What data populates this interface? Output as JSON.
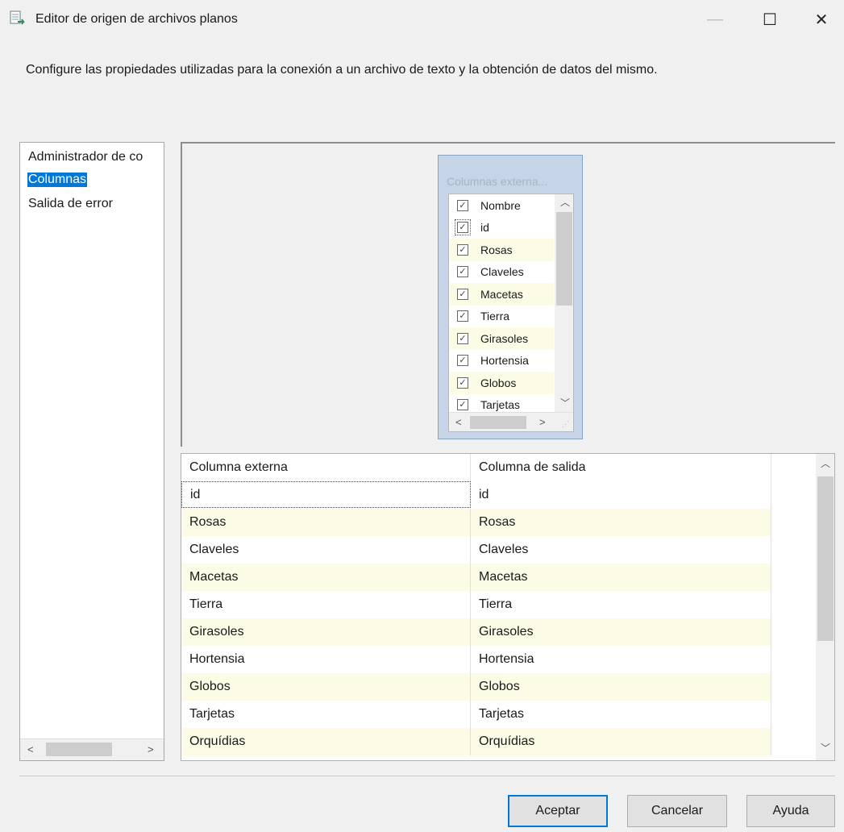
{
  "window": {
    "title": "Editor de origen de archivos planos",
    "minimize_glyph": "—",
    "maximize_glyph": "☐",
    "close_glyph": "✕",
    "icon": "flat-file-source-icon"
  },
  "description": "Configure las propiedades utilizadas para la conexión a un archivo de texto y la obtención de datos del mismo.",
  "nav": {
    "items": [
      {
        "label": "Administrador de co",
        "selected": false
      },
      {
        "label": "Columnas",
        "selected": true
      },
      {
        "label": "Salida de error",
        "selected": false
      }
    ]
  },
  "external_columns": {
    "title": "Columnas externa...",
    "items": [
      {
        "label": "Nombre",
        "checked": true
      },
      {
        "label": "id",
        "checked": true
      },
      {
        "label": "Rosas",
        "checked": true
      },
      {
        "label": "Claveles",
        "checked": true
      },
      {
        "label": "Macetas",
        "checked": true
      },
      {
        "label": "Tierra",
        "checked": true
      },
      {
        "label": "Girasoles",
        "checked": true
      },
      {
        "label": "Hortensia",
        "checked": true
      },
      {
        "label": "Globos",
        "checked": true
      },
      {
        "label": "Tarjetas",
        "checked": true
      }
    ]
  },
  "grid": {
    "headers": [
      "Columna externa",
      "Columna de salida"
    ],
    "rows": [
      [
        "id",
        "id"
      ],
      [
        "Rosas",
        "Rosas"
      ],
      [
        "Claveles",
        "Claveles"
      ],
      [
        "Macetas",
        "Macetas"
      ],
      [
        "Tierra",
        "Tierra"
      ],
      [
        "Girasoles",
        "Girasoles"
      ],
      [
        "Hortensia",
        "Hortensia"
      ],
      [
        "Globos",
        "Globos"
      ],
      [
        "Tarjetas",
        "Tarjetas"
      ],
      [
        "Orquídias",
        "Orquídias"
      ]
    ]
  },
  "buttons": {
    "ok": "Aceptar",
    "cancel": "Cancelar",
    "help": "Ayuda"
  },
  "colors": {
    "selection": "#0078d7",
    "alt_row": "#fbfbe6",
    "list_box": "#c5d4e6"
  }
}
